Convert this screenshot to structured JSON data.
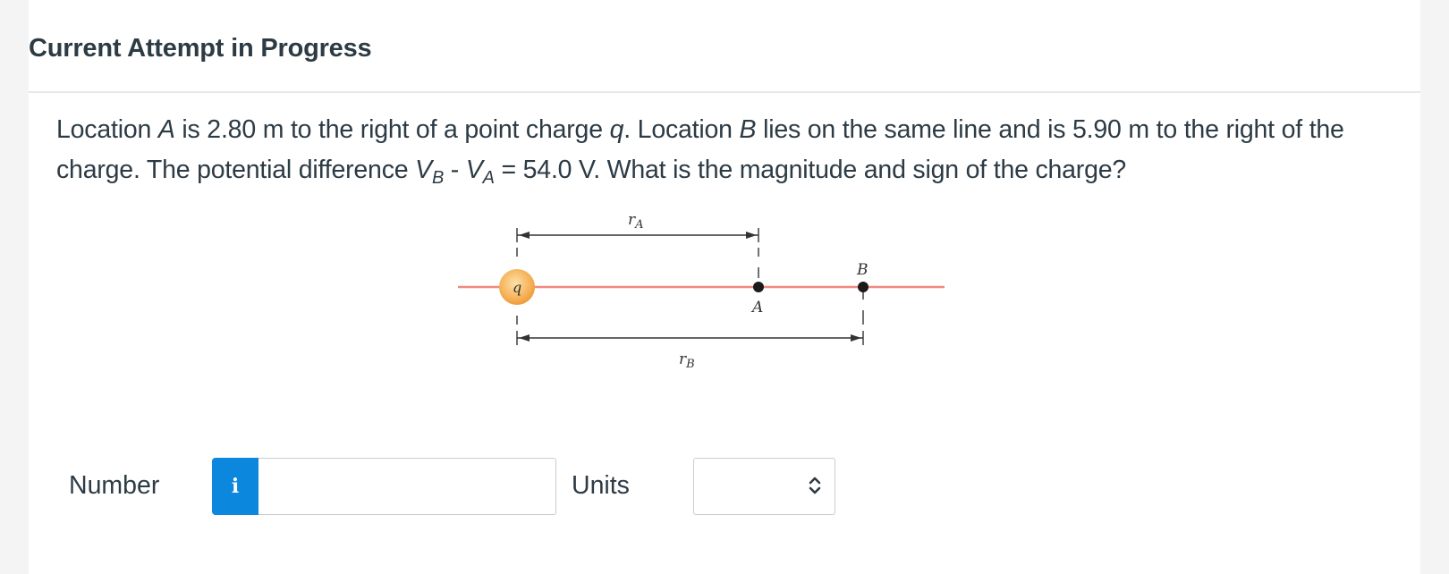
{
  "header": {
    "title": "Current Attempt in Progress"
  },
  "question": {
    "part1": "Location ",
    "A": "A",
    "part2": " is 2.80 m to the right of a point charge ",
    "q": "q",
    "part3": ". Location ",
    "B": "B",
    "part4": " lies on the same line and is 5.90 m to the right of the charge. The potential difference ",
    "V": "V",
    "subB": "B",
    "part5": " - ",
    "V2": "V",
    "subA": "A",
    "part6": " = 54.0 V. What is the magnitude and sign of the charge?"
  },
  "diagram": {
    "charge_label": "q",
    "point_a_label": "A",
    "point_b_label": "B",
    "ra_label": "r",
    "ra_sub": "A",
    "rb_label": "r",
    "rb_sub": "B",
    "line_color": "#f08a7e",
    "charge_color": "#f6b35b"
  },
  "answer": {
    "number_label": "Number",
    "info_icon": "i",
    "number_value": "",
    "units_label": "Units",
    "units_value": ""
  }
}
